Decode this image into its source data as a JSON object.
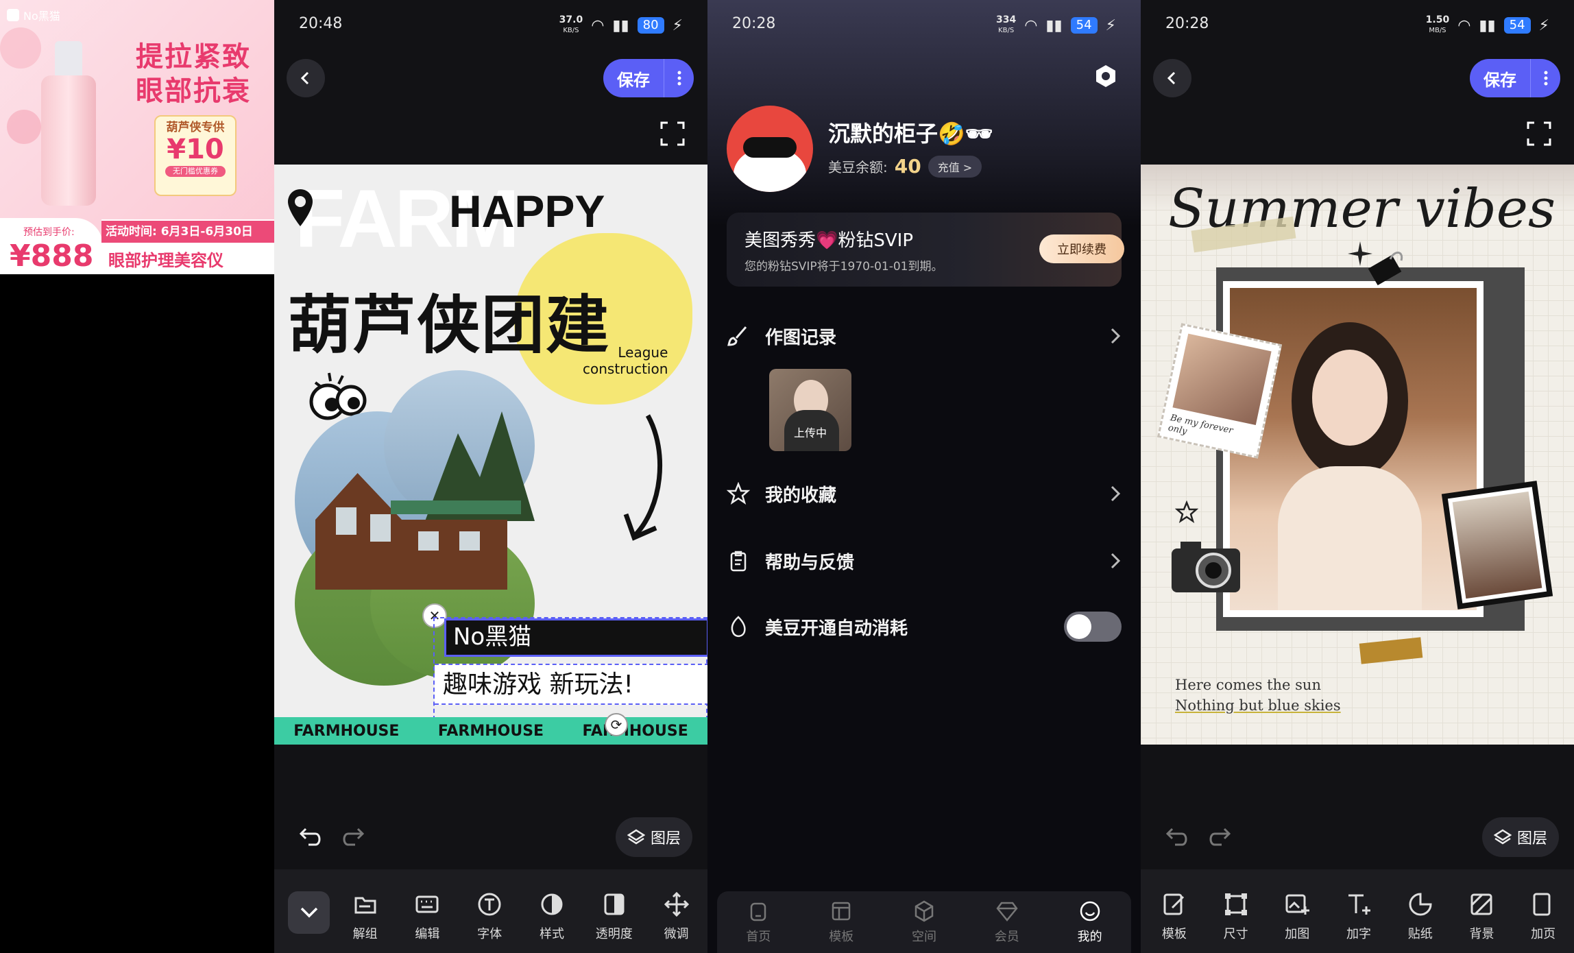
{
  "panel1": {
    "brand": "No黑猫",
    "headline_1": "提拉紧致",
    "headline_2": "眼部抗衰",
    "promo_tag": "葫芦侠专供",
    "promo_price": "¥10",
    "promo_note": "无门槛优惠券",
    "estimate_label": "预估到手价:",
    "estimate_price": "¥888",
    "activity": "活动时间: 6月3日-6月30日",
    "product": "眼部护理美容仪"
  },
  "panel2": {
    "status": {
      "time": "20:48",
      "speed": "37.0",
      "speed_unit": "KB/S",
      "battery": "80"
    },
    "save_label": "保存",
    "canvas": {
      "farm": "FARM",
      "happy": "HAPPY",
      "title": "葫芦侠团建",
      "league_1": "League",
      "league_2": "construction",
      "overlay_1": "No黑猫",
      "overlay_2": "趣味游戏 新玩法!",
      "strip": [
        "FARMHOUSE",
        "FARMHOUSE",
        "FARMHOUSE"
      ]
    },
    "layers_label": "图层",
    "tools": [
      "解组",
      "编辑",
      "字体",
      "样式",
      "透明度",
      "微调"
    ]
  },
  "panel3": {
    "status": {
      "time": "20:28",
      "speed": "334",
      "speed_unit": "KB/S",
      "battery": "54"
    },
    "username": "沉默的柜子🤣🕶",
    "beans_label": "美豆余额:",
    "beans_value": "40",
    "recharge_label": "充值 >",
    "vip_title": "美图秀秀💗粉钻SVIP",
    "vip_sub": "您的粉钻SVIP将于1970-01-01到期。",
    "renew_label": "立即续费",
    "menu": {
      "records": "作图记录",
      "uploading": "上传中",
      "favorites": "我的收藏",
      "help": "帮助与反馈",
      "auto_beans": "美豆开通自动消耗"
    },
    "tabs": [
      "首页",
      "模板",
      "空间",
      "会员",
      "我的"
    ]
  },
  "panel4": {
    "status": {
      "time": "20:28",
      "speed": "1.50",
      "speed_unit": "MB/S",
      "battery": "54"
    },
    "save_label": "保存",
    "canvas": {
      "title": "Summer vibes",
      "stamp_caption": "Be my forever only",
      "footer_1": "Here comes the sun",
      "footer_2": "Nothing but blue skies"
    },
    "layers_label": "图层",
    "tools": [
      "模板",
      "尺寸",
      "加图",
      "加字",
      "贴纸",
      "背景",
      "加页"
    ]
  }
}
